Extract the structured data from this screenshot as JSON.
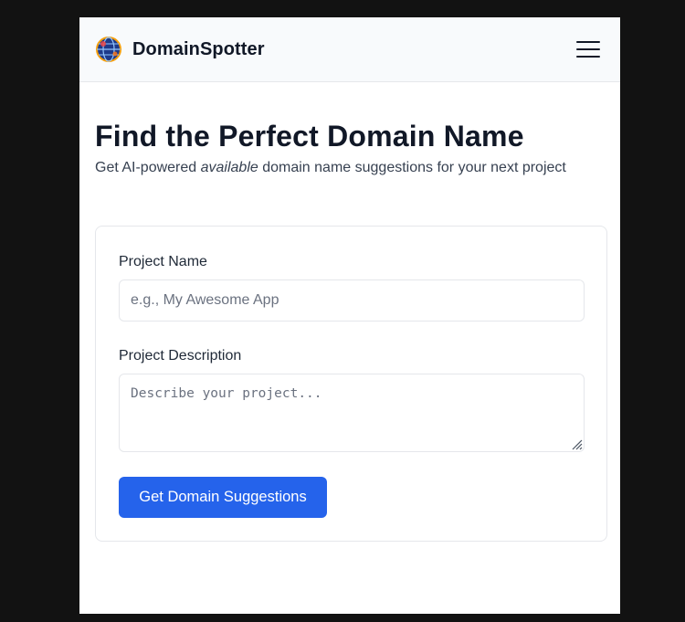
{
  "navbar": {
    "brand_name": "DomainSpotter",
    "logo_icon": "globe-logo-icon",
    "menu_icon": "hamburger-menu-icon"
  },
  "hero": {
    "title": "Find the Perfect Domain Name",
    "subtitle_before": "Get AI-powered ",
    "subtitle_emphasis": "available",
    "subtitle_after": " domain name suggestions for your next project"
  },
  "form": {
    "project_name": {
      "label": "Project Name",
      "placeholder": "e.g., My Awesome App",
      "value": ""
    },
    "project_description": {
      "label": "Project Description",
      "placeholder": "Describe your project...",
      "value": ""
    },
    "submit_label": "Get Domain Suggestions"
  },
  "colors": {
    "page_background": "#121212",
    "navbar_background": "#f8fafc",
    "primary_button": "#2563eb",
    "heading_text": "#111827",
    "border": "#e5e7eb"
  }
}
